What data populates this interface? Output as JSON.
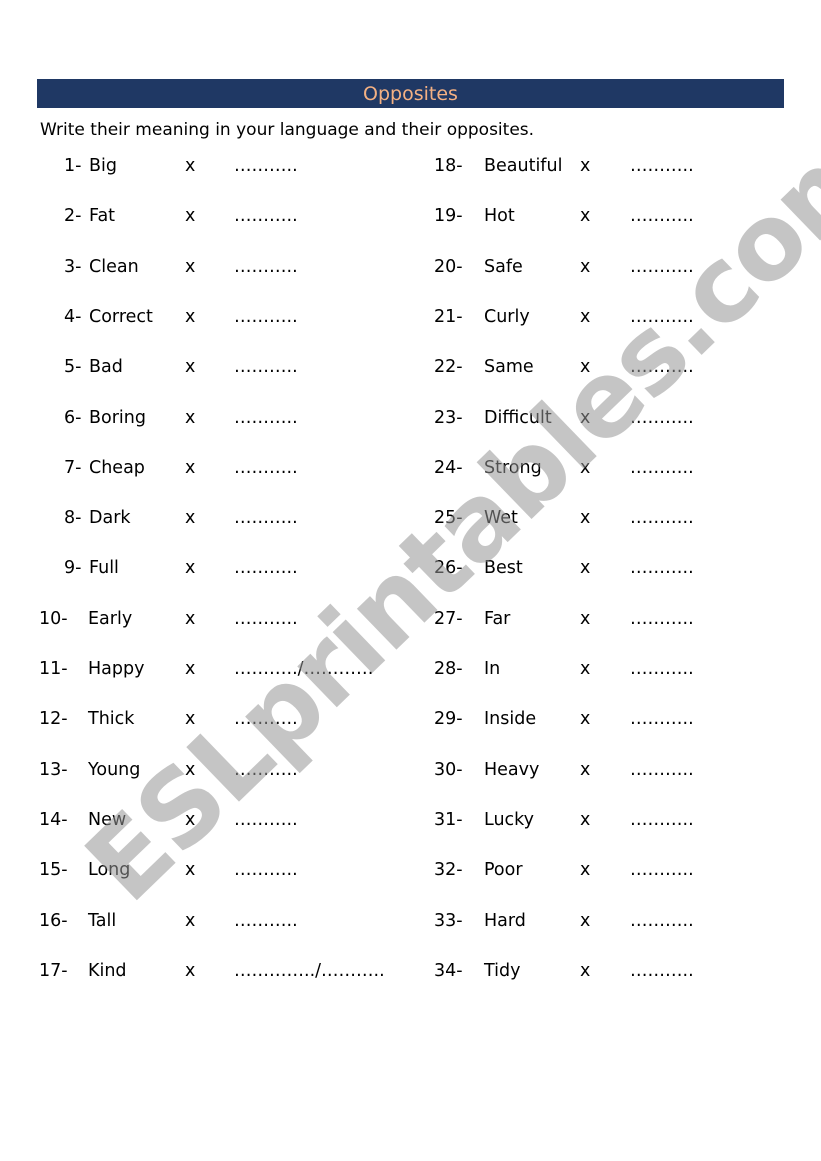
{
  "header": {
    "title": "Opposites",
    "bar_color": "#1f3864",
    "title_color": "#f4b183"
  },
  "instructions": "Write their meaning in your language and their opposites.",
  "separator": "x",
  "left_column": [
    {
      "num": "1-",
      "word": "Big",
      "blank": "………..",
      "compact": true
    },
    {
      "num": "2-",
      "word": "Fat",
      "blank": " ………..",
      "compact": true
    },
    {
      "num": "3-",
      "word": "Clean",
      "blank": "………..",
      "compact": true
    },
    {
      "num": "4-",
      "word": "Correct",
      "blank": "………..",
      "compact": true
    },
    {
      "num": "5-",
      "word": "Bad",
      "blank": "………..",
      "compact": true
    },
    {
      "num": "6-",
      "word": "Boring",
      "blank": "………..",
      "compact": true
    },
    {
      "num": "7-",
      "word": "Cheap",
      "blank": "………..",
      "compact": true
    },
    {
      "num": "8-",
      "word": "Dark",
      "blank": "………..",
      "compact": true
    },
    {
      "num": "9-",
      "word": "Full",
      "blank": "………..",
      "compact": true
    },
    {
      "num": "10-",
      "word": "Early",
      "blank": "………..",
      "compact": false
    },
    {
      "num": "11-",
      "word": "Happy",
      "blank": "………../…………",
      "compact": false
    },
    {
      "num": "12-",
      "word": "Thick",
      "blank": "………..",
      "compact": false
    },
    {
      "num": "13-",
      "word": "Young",
      "blank": "………..",
      "compact": false
    },
    {
      "num": "14-",
      "word": "New",
      "blank": "………..",
      "compact": false
    },
    {
      "num": "15-",
      "word": "Long",
      "blank": "………..",
      "compact": false
    },
    {
      "num": "16-",
      "word": "Tall",
      "blank": "………..",
      "compact": false
    },
    {
      "num": "17-",
      "word": "Kind",
      "blank": "…………../………..",
      "compact": false
    }
  ],
  "right_column": [
    {
      "num": "18-",
      "word": "Beautiful",
      "blank": "……….."
    },
    {
      "num": "19-",
      "word": "Hot",
      "blank": "……….."
    },
    {
      "num": "20-",
      "word": "Safe",
      "blank": "……….."
    },
    {
      "num": "21-",
      "word": "Curly",
      "blank": "……….."
    },
    {
      "num": "22-",
      "word": "Same",
      "blank": "……….."
    },
    {
      "num": "23-",
      "word": "Difficult",
      "blank": "……….."
    },
    {
      "num": "24-",
      "word": "Strong",
      "blank": "……….."
    },
    {
      "num": "25-",
      "word": "Wet",
      "blank": "……….."
    },
    {
      "num": "26-",
      "word": "Best",
      "blank": "……….."
    },
    {
      "num": "27-",
      "word": "Far",
      "blank": "……….."
    },
    {
      "num": "28-",
      "word": "In",
      "blank": "……….."
    },
    {
      "num": "29-",
      "word": "Inside",
      "blank": "……….."
    },
    {
      "num": "30-",
      "word": "Heavy",
      "blank": "……….."
    },
    {
      "num": "31-",
      "word": "Lucky",
      "blank": "……….."
    },
    {
      "num": "32-",
      "word": "Poor",
      "blank": "……….."
    },
    {
      "num": "33-",
      "word": "Hard",
      "blank": "……….."
    },
    {
      "num": "34-",
      "word": "Tidy",
      "blank": "……….."
    }
  ],
  "watermark": "ESLprintables.com"
}
